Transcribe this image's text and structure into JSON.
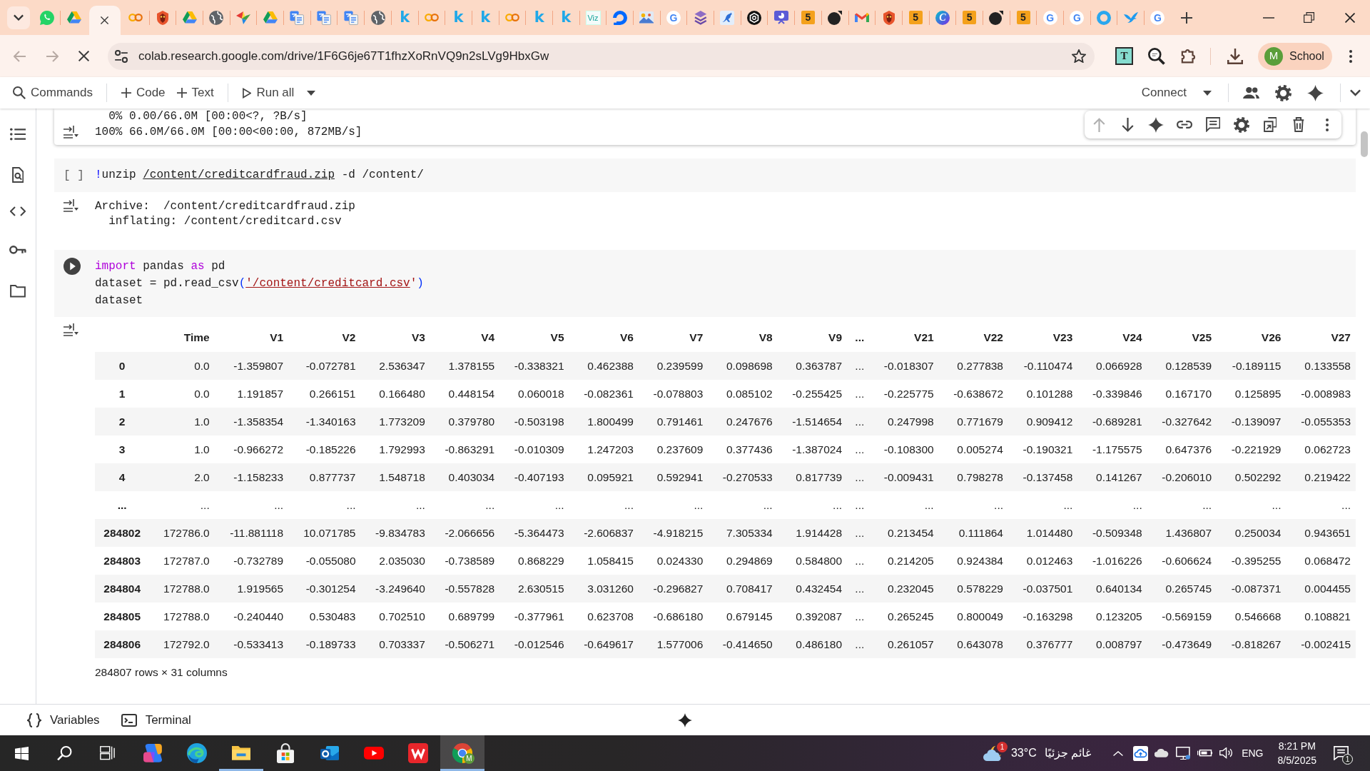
{
  "browser": {
    "tabs": [
      {
        "kind": "chat",
        "selected": false
      },
      {
        "kind": "triangle",
        "selected": false
      },
      {
        "selected": true
      },
      {
        "kind": "rings",
        "selected": false
      },
      {
        "kind": "crest",
        "selected": false
      },
      {
        "kind": "triangle",
        "selected": false
      },
      {
        "kind": "globe",
        "selected": false
      },
      {
        "kind": "crane",
        "selected": false
      },
      {
        "kind": "triangle",
        "selected": false
      },
      {
        "kind": "translate",
        "selected": false
      },
      {
        "kind": "translate",
        "selected": false
      },
      {
        "kind": "translate",
        "selected": false
      },
      {
        "kind": "globe",
        "selected": false
      },
      {
        "kind": "letter",
        "glyph": "k",
        "selected": false
      },
      {
        "kind": "rings",
        "selected": false
      },
      {
        "kind": "letter",
        "glyph": "k",
        "selected": false
      },
      {
        "kind": "letter",
        "glyph": "k",
        "selected": false
      },
      {
        "kind": "rings",
        "selected": false
      },
      {
        "kind": "letter",
        "glyph": "k",
        "selected": false
      },
      {
        "kind": "letter",
        "glyph": "k",
        "selected": false
      },
      {
        "kind": "wordmark",
        "glyph": "Viz",
        "selected": false
      },
      {
        "kind": "arc",
        "selected": false
      },
      {
        "kind": "picture",
        "selected": false
      },
      {
        "kind": "badge",
        "glyph": "G",
        "selected": false
      },
      {
        "kind": "layers",
        "selected": false
      },
      {
        "kind": "kangaroo",
        "selected": false
      },
      {
        "kind": "knot",
        "selected": false
      },
      {
        "kind": "presentation",
        "selected": false
      },
      {
        "kind": "tile",
        "glyph": "5",
        "selected": false
      },
      {
        "kind": "ball",
        "selected": false
      },
      {
        "kind": "envelope",
        "selected": false
      },
      {
        "kind": "crest",
        "selected": false
      },
      {
        "kind": "tile",
        "glyph": "5",
        "selected": false
      },
      {
        "kind": "disc",
        "glyph": "C",
        "selected": false
      },
      {
        "kind": "tile",
        "glyph": "5",
        "selected": false
      },
      {
        "kind": "ball",
        "selected": false
      },
      {
        "kind": "tile",
        "glyph": "5",
        "selected": false
      },
      {
        "kind": "badge",
        "glyph": "G",
        "selected": false
      },
      {
        "kind": "badge",
        "glyph": "G",
        "selected": false
      },
      {
        "kind": "ring",
        "selected": false
      },
      {
        "kind": "bird",
        "selected": false
      },
      {
        "kind": "badge",
        "glyph": "G",
        "selected": false
      }
    ],
    "nav": [
      {
        "kind": "back",
        "disabled": true
      },
      {
        "kind": "forward",
        "disabled": true
      },
      {
        "kind": "stop",
        "disabled": false
      }
    ],
    "url": "colab.research.google.com/drive/1F6G6je67T1fhzXoRnVQ9n2sLVg9HbxGw",
    "extensions": [
      {
        "kind": "frame",
        "glyph": "T"
      },
      {
        "kind": "magnifier"
      },
      {
        "kind": "puzzle"
      }
    ],
    "profile": {
      "initial": "M",
      "label": "School"
    }
  },
  "toolbar": {
    "groups": [
      [
        {
          "kind": "search",
          "label": "Commands",
          "menu": false
        }
      ],
      [
        {
          "kind": "add",
          "label": "Code",
          "menu": false
        },
        {
          "kind": "add",
          "label": "Text",
          "menu": false
        }
      ],
      [
        {
          "kind": "run",
          "label": "Run all",
          "menu": true
        }
      ]
    ],
    "connect": {
      "label": "Connect",
      "menu": true
    },
    "actions": [
      {
        "kind": "people"
      },
      {
        "kind": "gear"
      },
      {
        "kind": "sparkle"
      }
    ]
  },
  "rail": [
    {
      "kind": "list"
    },
    {
      "kind": "docsearch"
    },
    {
      "kind": "code"
    },
    {
      "kind": "key"
    },
    {
      "kind": "folder"
    }
  ],
  "cells": [
    {
      "focused": true,
      "toolbar": [
        {
          "kind": "up",
          "disabled": true
        },
        {
          "kind": "down",
          "disabled": false
        },
        {
          "kind": "sparkle",
          "disabled": false
        },
        {
          "kind": "link",
          "disabled": false
        },
        {
          "kind": "comment",
          "disabled": false
        },
        {
          "kind": "gear",
          "disabled": false
        },
        {
          "kind": "mirror",
          "disabled": false
        },
        {
          "kind": "trash",
          "disabled": false
        },
        {
          "kind": "more",
          "disabled": false
        }
      ],
      "output": {
        "lines": [
          "  0% 0.00/66.0M [00:00<?, ?B/s]",
          "100% 66.0M/66.0M [00:00<00:00, 872MB/s]"
        ]
      }
    },
    {
      "focused": false,
      "hovered": false,
      "count": "[ ]",
      "code": [
        [
          {
            "kind": "shell",
            "text": "!"
          },
          {
            "kind": "plain",
            "text": "unzip "
          },
          {
            "kind": "path",
            "text": "/content/creditcardfraud.zip"
          },
          {
            "kind": "plain",
            "text": " -d /content/"
          }
        ]
      ],
      "output": {
        "lines": [
          "Archive:  /content/creditcardfraud.zip",
          "  inflating: /content/creditcard.csv"
        ]
      }
    },
    {
      "focused": false,
      "hovered": true,
      "code": [
        [
          {
            "kind": "keyword",
            "text": "import"
          },
          {
            "kind": "plain",
            "text": " pandas "
          },
          {
            "kind": "keyword",
            "text": "as"
          },
          {
            "kind": "plain",
            "text": " pd"
          }
        ],
        [
          {
            "kind": "plain",
            "text": "dataset = pd.read_csv"
          },
          {
            "kind": "paren",
            "text": "("
          },
          {
            "kind": "string-path",
            "text": "'/content/creditcard.csv"
          },
          {
            "kind": "string",
            "text": "'"
          },
          {
            "kind": "paren",
            "text": ")"
          }
        ],
        [
          {
            "kind": "plain",
            "text": "dataset"
          }
        ]
      ],
      "output": {
        "table": {
          "columns": [
            "Time",
            "V1",
            "V2",
            "V3",
            "V4",
            "V5",
            "V6",
            "V7",
            "V8",
            "V9",
            "...",
            "V21",
            "V22",
            "V23",
            "V24",
            "V25",
            "V26",
            "V27"
          ],
          "rows": [
            {
              "index": "0",
              "cells": [
                "0.0",
                "-1.359807",
                "-0.072781",
                "2.536347",
                "1.378155",
                "-0.338321",
                "0.462388",
                "0.239599",
                "0.098698",
                "0.363787",
                "...",
                "-0.018307",
                "0.277838",
                "-0.110474",
                "0.066928",
                "0.128539",
                "-0.189115",
                "0.133558"
              ]
            },
            {
              "index": "1",
              "cells": [
                "0.0",
                "1.191857",
                "0.266151",
                "0.166480",
                "0.448154",
                "0.060018",
                "-0.082361",
                "-0.078803",
                "0.085102",
                "-0.255425",
                "...",
                "-0.225775",
                "-0.638672",
                "0.101288",
                "-0.339846",
                "0.167170",
                "0.125895",
                "-0.008983"
              ]
            },
            {
              "index": "2",
              "cells": [
                "1.0",
                "-1.358354",
                "-1.340163",
                "1.773209",
                "0.379780",
                "-0.503198",
                "1.800499",
                "0.791461",
                "0.247676",
                "-1.514654",
                "...",
                "0.247998",
                "0.771679",
                "0.909412",
                "-0.689281",
                "-0.327642",
                "-0.139097",
                "-0.055353"
              ]
            },
            {
              "index": "3",
              "cells": [
                "1.0",
                "-0.966272",
                "-0.185226",
                "1.792993",
                "-0.863291",
                "-0.010309",
                "1.247203",
                "0.237609",
                "0.377436",
                "-1.387024",
                "...",
                "-0.108300",
                "0.005274",
                "-0.190321",
                "-1.175575",
                "0.647376",
                "-0.221929",
                "0.062723"
              ]
            },
            {
              "index": "4",
              "cells": [
                "2.0",
                "-1.158233",
                "0.877737",
                "1.548718",
                "0.403034",
                "-0.407193",
                "0.095921",
                "0.592941",
                "-0.270533",
                "0.817739",
                "...",
                "-0.009431",
                "0.798278",
                "-0.137458",
                "0.141267",
                "-0.206010",
                "0.502292",
                "0.219422"
              ]
            },
            {
              "index": "...",
              "cells": [
                "...",
                "...",
                "...",
                "...",
                "...",
                "...",
                "...",
                "...",
                "...",
                "...",
                "...",
                "...",
                "...",
                "...",
                "...",
                "...",
                "...",
                "..."
              ]
            },
            {
              "index": "284802",
              "cells": [
                "172786.0",
                "-11.881118",
                "10.071785",
                "-9.834783",
                "-2.066656",
                "-5.364473",
                "-2.606837",
                "-4.918215",
                "7.305334",
                "1.914428",
                "...",
                "0.213454",
                "0.111864",
                "1.014480",
                "-0.509348",
                "1.436807",
                "0.250034",
                "0.943651"
              ]
            },
            {
              "index": "284803",
              "cells": [
                "172787.0",
                "-0.732789",
                "-0.055080",
                "2.035030",
                "-0.738589",
                "0.868229",
                "1.058415",
                "0.024330",
                "0.294869",
                "0.584800",
                "...",
                "0.214205",
                "0.924384",
                "0.012463",
                "-1.016226",
                "-0.606624",
                "-0.395255",
                "0.068472"
              ]
            },
            {
              "index": "284804",
              "cells": [
                "172788.0",
                "1.919565",
                "-0.301254",
                "-3.249640",
                "-0.557828",
                "2.630515",
                "3.031260",
                "-0.296827",
                "0.708417",
                "0.432454",
                "...",
                "0.232045",
                "0.578229",
                "-0.037501",
                "0.640134",
                "0.265745",
                "-0.087371",
                "0.004455"
              ]
            },
            {
              "index": "284805",
              "cells": [
                "172788.0",
                "-0.240440",
                "0.530483",
                "0.702510",
                "0.689799",
                "-0.377961",
                "0.623708",
                "-0.686180",
                "0.679145",
                "0.392087",
                "...",
                "0.265245",
                "0.800049",
                "-0.163298",
                "0.123205",
                "-0.569159",
                "0.546668",
                "0.108821"
              ]
            },
            {
              "index": "284806",
              "cells": [
                "172792.0",
                "-0.533413",
                "-0.189733",
                "0.703337",
                "-0.506271",
                "-0.012546",
                "-0.649617",
                "1.577006",
                "-0.414650",
                "0.486180",
                "...",
                "0.261057",
                "0.643078",
                "0.376777",
                "0.008797",
                "-0.473649",
                "-0.818267",
                "-0.002415"
              ]
            }
          ]
        },
        "shape": "284807 rows × 31 columns"
      }
    }
  ],
  "status_bar": {
    "items": [
      {
        "kind": "braces",
        "label": "Variables"
      },
      {
        "kind": "terminal",
        "label": "Terminal"
      }
    ],
    "sparkle_button": true
  },
  "taskbar": {
    "apps": [
      {
        "kind": "start",
        "open": false,
        "selected": false
      },
      {
        "kind": "search",
        "open": false,
        "selected": false
      },
      {
        "kind": "taskview",
        "open": false,
        "selected": false
      },
      {
        "kind": "ribbon",
        "open": false,
        "selected": false
      },
      {
        "kind": "wave",
        "open": false,
        "selected": false
      },
      {
        "kind": "folder",
        "open": true,
        "selected": false
      },
      {
        "kind": "bag",
        "open": false,
        "selected": false
      },
      {
        "kind": "mail",
        "open": false,
        "selected": false
      },
      {
        "kind": "video",
        "open": false,
        "selected": false
      },
      {
        "kind": "zigzag",
        "open": false,
        "selected": false
      },
      {
        "kind": "segments",
        "open": true,
        "selected": true,
        "badge": "M"
      }
    ],
    "weather": {
      "badge": "1",
      "temperature": "33°C",
      "condition": "غائم جزئيًا"
    },
    "tray": [
      {
        "kind": "chevron"
      },
      {
        "kind": "cloud-sync"
      },
      {
        "kind": "cloud"
      },
      {
        "kind": "display"
      },
      {
        "kind": "battery"
      },
      {
        "kind": "volume"
      }
    ],
    "language": "ENG",
    "time": "8:21 PM",
    "date": "8/5/2025",
    "notifications": "1"
  }
}
